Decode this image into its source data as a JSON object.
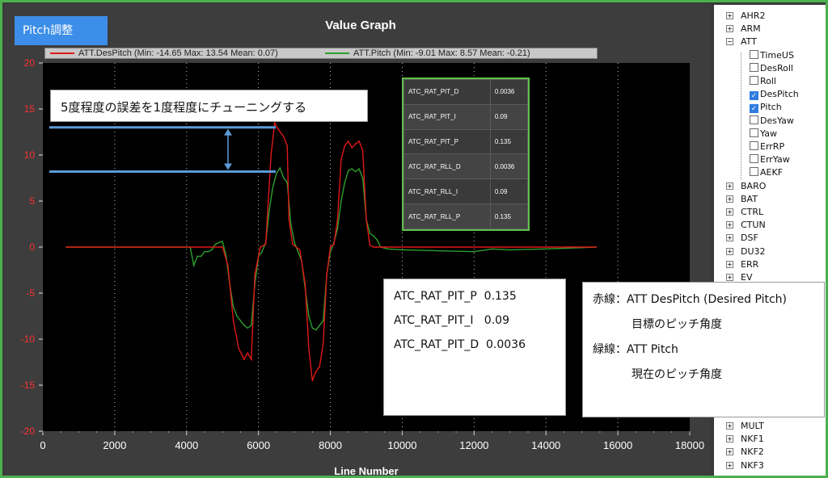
{
  "badge": "Pitch調整",
  "chart_data": {
    "type": "line",
    "title": "Value Graph",
    "xlabel": "Line Number",
    "ylabel": "",
    "xlim": [
      0,
      18000
    ],
    "ylim": [
      -20,
      20
    ],
    "x_ticks": [
      "0",
      "2000",
      "4000",
      "6000",
      "8000",
      "10000",
      "12000",
      "14000",
      "16000",
      "18000"
    ],
    "y_ticks": [
      "20",
      "15",
      "10",
      "5",
      "0",
      "-5",
      "-10",
      "-15",
      "-20"
    ],
    "grid": "dotted vertical",
    "legend_position": "top",
    "series": [
      {
        "name": "ATT.DesPitch (Min: -14.65 Max: 13.54 Mean: 0.07)",
        "color": "#e01818",
        "x": [
          650,
          4500,
          5000,
          5150,
          5300,
          5450,
          5600,
          5700,
          5800,
          5900,
          6050,
          6200,
          6350,
          6450,
          6550,
          6700,
          6800,
          6850,
          6950,
          7050,
          7150,
          7300,
          7400,
          7500,
          7600,
          7700,
          7800,
          7900,
          8000,
          8100,
          8200,
          8300,
          8400,
          8500,
          8600,
          8700,
          8800,
          8900,
          9000,
          9100,
          9200,
          9300,
          9500,
          15400
        ],
        "y": [
          0,
          0,
          0,
          -2,
          -8,
          -11,
          -12.2,
          -11.5,
          -12.2,
          -3,
          0,
          0.3,
          10,
          13.5,
          12.8,
          12,
          11,
          3,
          0.3,
          0,
          -0.3,
          -4,
          -11,
          -14.5,
          -13.5,
          -13,
          -10.5,
          -3,
          0,
          0.3,
          3,
          9.5,
          11,
          11.5,
          10.8,
          11.2,
          11.5,
          10.5,
          3,
          0.2,
          0,
          0,
          0,
          0
        ]
      },
      {
        "name": "ATT.Pitch (Min: -9.01 Max: 8.57 Mean: -0.21)",
        "color": "#2d9e2d",
        "x": [
          650,
          4100,
          4200,
          4300,
          4400,
          4500,
          4600,
          4700,
          4800,
          4900,
          5000,
          5100,
          5200,
          5300,
          5400,
          5500,
          5600,
          5700,
          5800,
          5900,
          6000,
          6100,
          6200,
          6300,
          6400,
          6500,
          6600,
          6700,
          6800,
          6900,
          7000,
          7100,
          7200,
          7300,
          7400,
          7500,
          7600,
          7700,
          7800,
          7900,
          8000,
          8100,
          8200,
          8300,
          8400,
          8500,
          8600,
          8700,
          8800,
          8900,
          9000,
          9100,
          9200,
          9300,
          9400,
          9600,
          10000,
          11000,
          12000,
          12500,
          13000,
          14000,
          15400
        ],
        "y": [
          0,
          0,
          -2,
          -1,
          -1,
          -0.5,
          -0.5,
          -0.3,
          0.3,
          0.5,
          0.6,
          -1,
          -4,
          -6.5,
          -7.5,
          -8,
          -8.5,
          -8.8,
          -8.5,
          -4,
          -1,
          -0.5,
          0.5,
          4,
          6.5,
          8,
          8.6,
          7.5,
          7,
          2.5,
          0.5,
          -0.5,
          -1.5,
          -4.5,
          -7.5,
          -8.8,
          -9,
          -8.5,
          -8,
          -3,
          -0.5,
          0.5,
          2,
          5,
          7,
          8.3,
          8.5,
          8.2,
          8.5,
          7.5,
          3,
          1.5,
          1.2,
          0.8,
          0,
          -0.2,
          -0.3,
          -0.4,
          -0.5,
          -0.2,
          -0.3,
          -0.2,
          0
        ]
      }
    ],
    "annotation": "5度程度の誤差を1度程度にチューニングする"
  },
  "param_table": [
    {
      "name": "ATC_RAT_PIT_D",
      "value": "0.0036"
    },
    {
      "name": "ATC_RAT_PIT_I",
      "value": "0.09"
    },
    {
      "name": "ATC_RAT_PIT_P",
      "value": "0.135"
    },
    {
      "name": "ATC_RAT_RLL_D",
      "value": "0.0036"
    },
    {
      "name": "ATC_RAT_RLL_I",
      "value": "0.09"
    },
    {
      "name": "ATC_RAT_RLL_P",
      "value": "0.135"
    }
  ],
  "params_box": [
    "ATC_RAT_PIT_P  0.135",
    "ATC_RAT_PIT_I   0.09",
    "ATC_RAT_PIT_D  0.0036"
  ],
  "legend_box": {
    "red_label": "赤線：ATT DesPitch (Desired Pitch)",
    "red_desc": "目標のピッチ角度",
    "green_label": "緑線：ATT Pitch",
    "green_desc": "現在のピッチ角度"
  },
  "tree": [
    {
      "label": "AHR2",
      "kind": "group",
      "expander": "+"
    },
    {
      "label": "ARM",
      "kind": "group",
      "expander": "+"
    },
    {
      "label": "ATT",
      "kind": "group",
      "expander": "−"
    },
    {
      "label": "TimeUS",
      "kind": "child",
      "checked": false
    },
    {
      "label": "DesRoll",
      "kind": "child",
      "checked": false
    },
    {
      "label": "Roll",
      "kind": "child",
      "checked": false
    },
    {
      "label": "DesPitch",
      "kind": "child",
      "checked": true
    },
    {
      "label": "Pitch",
      "kind": "child",
      "checked": true
    },
    {
      "label": "DesYaw",
      "kind": "child",
      "checked": false
    },
    {
      "label": "Yaw",
      "kind": "child",
      "checked": false
    },
    {
      "label": "ErrRP",
      "kind": "child",
      "checked": false
    },
    {
      "label": "ErrYaw",
      "kind": "child",
      "checked": false
    },
    {
      "label": "AEKF",
      "kind": "child",
      "checked": false
    },
    {
      "label": "BARO",
      "kind": "group",
      "expander": "+"
    },
    {
      "label": "BAT",
      "kind": "group",
      "expander": "+"
    },
    {
      "label": "CTRL",
      "kind": "group",
      "expander": "+"
    },
    {
      "label": "CTUN",
      "kind": "group",
      "expander": "+"
    },
    {
      "label": "DSF",
      "kind": "group",
      "expander": "+"
    },
    {
      "label": "DU32",
      "kind": "group",
      "expander": "+"
    },
    {
      "label": "ERR",
      "kind": "group",
      "expander": "+"
    },
    {
      "label": "EV",
      "kind": "group",
      "expander": "+"
    }
  ],
  "tree_bottom": [
    {
      "label": "MULT",
      "expander": "+"
    },
    {
      "label": "NKF1",
      "expander": "+"
    },
    {
      "label": "NKF2",
      "expander": "+"
    },
    {
      "label": "NKF3",
      "expander": "+"
    }
  ]
}
